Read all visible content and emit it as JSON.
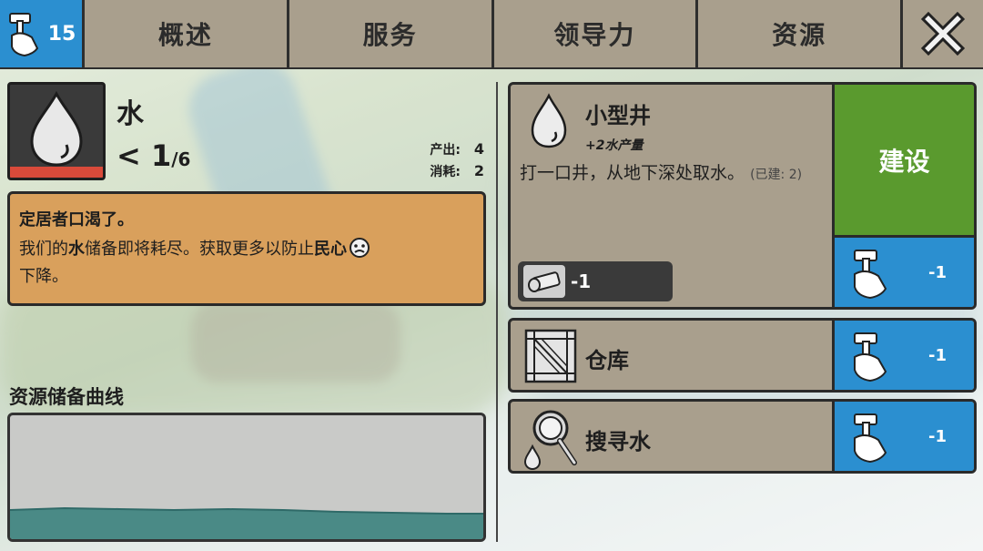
{
  "topbar": {
    "worker_count": "15",
    "tabs": [
      "概述",
      "服务",
      "领导力",
      "资源"
    ]
  },
  "resource": {
    "name": "水",
    "count_symbol": "< 1",
    "count_denominator": "/6",
    "produce_label": "产出:",
    "produce_value": "4",
    "consume_label": "消耗:",
    "consume_value": "2"
  },
  "alert": {
    "title": "定居者口渴了。",
    "line_part1": "我们的",
    "line_bold1": "水",
    "line_part2": "储备即将耗尽。获取更多以防止",
    "line_bold2": "民心",
    "line_part3": "下降。"
  },
  "curve": {
    "title": "资源储备曲线"
  },
  "buildings": [
    {
      "name": "小型井",
      "effect": "+2水产量",
      "desc": "打一口井，从地下深处取水。",
      "built_note": "(已建: 2)",
      "cost_value": "-1",
      "build_label": "建设",
      "worker_cost": "-1"
    },
    {
      "name": "仓库",
      "worker_cost": "-1"
    },
    {
      "name": "搜寻水",
      "worker_cost": "-1"
    }
  ],
  "colors": {
    "tab_bg": "#a99f8d",
    "blue": "#2b8fd0",
    "green": "#5a9a2e",
    "alert": "#d9a05c",
    "danger": "#d94a3a"
  }
}
